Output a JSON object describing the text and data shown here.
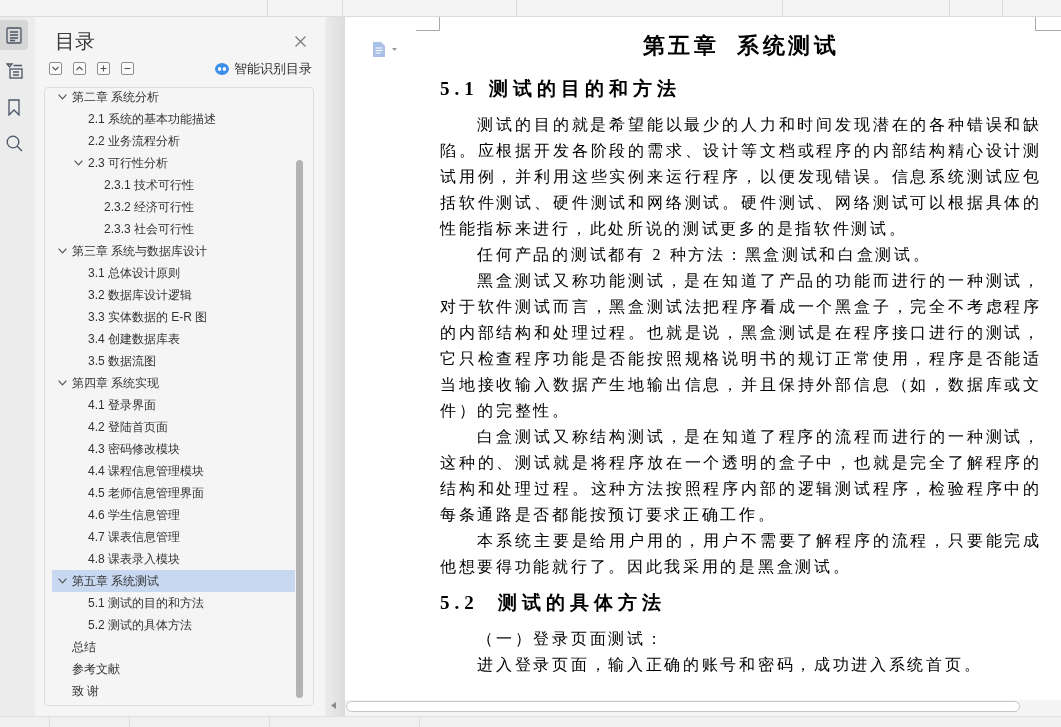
{
  "side_rail": {
    "tabs": [
      {
        "selected": true
      },
      {
        "selected": false
      },
      {
        "selected": false
      },
      {
        "selected": false
      }
    ]
  },
  "navigation_pane": {
    "title": "目录",
    "smart_toc_button": "智能识别目录",
    "items": [
      {
        "label": "第二章 系统分析",
        "selected": false,
        "expanded": true,
        "children": [
          {
            "label": "2.1 系统的基本功能描述",
            "selected": false
          },
          {
            "label": "2.2 业务流程分析",
            "selected": false
          },
          {
            "label": "2.3 可行性分析",
            "selected": false,
            "expanded": true,
            "children": [
              {
                "label": "2.3.1 技术可行性",
                "selected": false
              },
              {
                "label": "2.3.2 经济可行性",
                "selected": false
              },
              {
                "label": "2.3.3 社会可行性",
                "selected": false
              }
            ]
          }
        ]
      },
      {
        "label": "第三章 系统与数据库设计",
        "selected": false,
        "expanded": true,
        "children": [
          {
            "label": "3.1 总体设计原则",
            "selected": false
          },
          {
            "label": "3.2 数据库设计逻辑",
            "selected": false
          },
          {
            "label": "3.3 实体数据的 E-R 图",
            "selected": false
          },
          {
            "label": "3.4 创建数据库表",
            "selected": false
          },
          {
            "label": "3.5 数据流图",
            "selected": false
          }
        ]
      },
      {
        "label": "第四章 系统实现",
        "selected": false,
        "expanded": true,
        "children": [
          {
            "label": "4.1 登录界面",
            "selected": false
          },
          {
            "label": "4.2 登陆首页面",
            "selected": false
          },
          {
            "label": "4.3 密码修改模块",
            "selected": false
          },
          {
            "label": "4.4 课程信息管理模块",
            "selected": false
          },
          {
            "label": "4.5 老师信息管理界面",
            "selected": false
          },
          {
            "label": "4.6 学生信息管理",
            "selected": false
          },
          {
            "label": "4.7 课表信息管理",
            "selected": false
          },
          {
            "label": "4.8 课表录入模块",
            "selected": false
          }
        ]
      },
      {
        "label": "第五章 系统测试",
        "selected": true,
        "expanded": true,
        "children": [
          {
            "label": "5.1 测试的目的和方法",
            "selected": false
          },
          {
            "label": "5.2 测试的具体方法",
            "selected": false
          }
        ]
      },
      {
        "label": "总结",
        "selected": false
      },
      {
        "label": "参考文献",
        "selected": false
      },
      {
        "label": "致 谢",
        "selected": false
      }
    ]
  },
  "document": {
    "chapter_title": "第五章  系统测试",
    "blocks": [
      {
        "kind": "heading",
        "text": "5.1 测试的目的和方法"
      },
      {
        "kind": "paragraph",
        "text": "测试的目的就是希望能以最少的人力和时间发现潜在的各种错误和缺陷。应根据开发各阶段的需求、设计等文档或程序的内部结构精心设计测试用例，并利用这些实例来运行程序，以便发现错误。信息系统测试应包括软件测试、硬件测试和网络测试。硬件测试、网络测试可以根据具体的性能指标来进行，此处所说的测试更多的是指软件测试。"
      },
      {
        "kind": "paragraph",
        "text": "任何产品的测试都有 2 种方法：黑盒测试和白盒测试。"
      },
      {
        "kind": "paragraph",
        "text": "黑盒测试又称功能测试，是在知道了产品的功能而进行的一种测试，对于软件测试而言，黑盒测试法把程序看成一个黑盒子，完全不考虑程序的内部结构和处理过程。也就是说，黑盒测试是在程序接口进行的测试，它只检查程序功能是否能按照规格说明书的规订正常使用，程序是否能适当地接收输入数据产生地输出信息，并且保持外部信息（如，数据库或文件）的完整性。"
      },
      {
        "kind": "paragraph",
        "text": "白盒测试又称结构测试，是在知道了程序的流程而进行的一种测试，这种的、测试就是将程序放在一个透明的盒子中，也就是完全了解程序的结构和处理过程。这种方法按照程序内部的逻辑测试程序，检验程序中的每条通路是否都能按预订要求正确工作。"
      },
      {
        "kind": "paragraph",
        "text": "本系统主要是给用户用的，用户不需要了解程序的流程，只要能完成他想要得功能就行了。因此我采用的是黑盒测试。"
      },
      {
        "kind": "heading",
        "text": "5.2  测试的具体方法"
      },
      {
        "kind": "subheading",
        "text": "（一）登录页面测试："
      },
      {
        "kind": "paragraph",
        "text": "进入登录页面，输入正确的账号和密码，成功进入系统首页。"
      }
    ]
  }
}
